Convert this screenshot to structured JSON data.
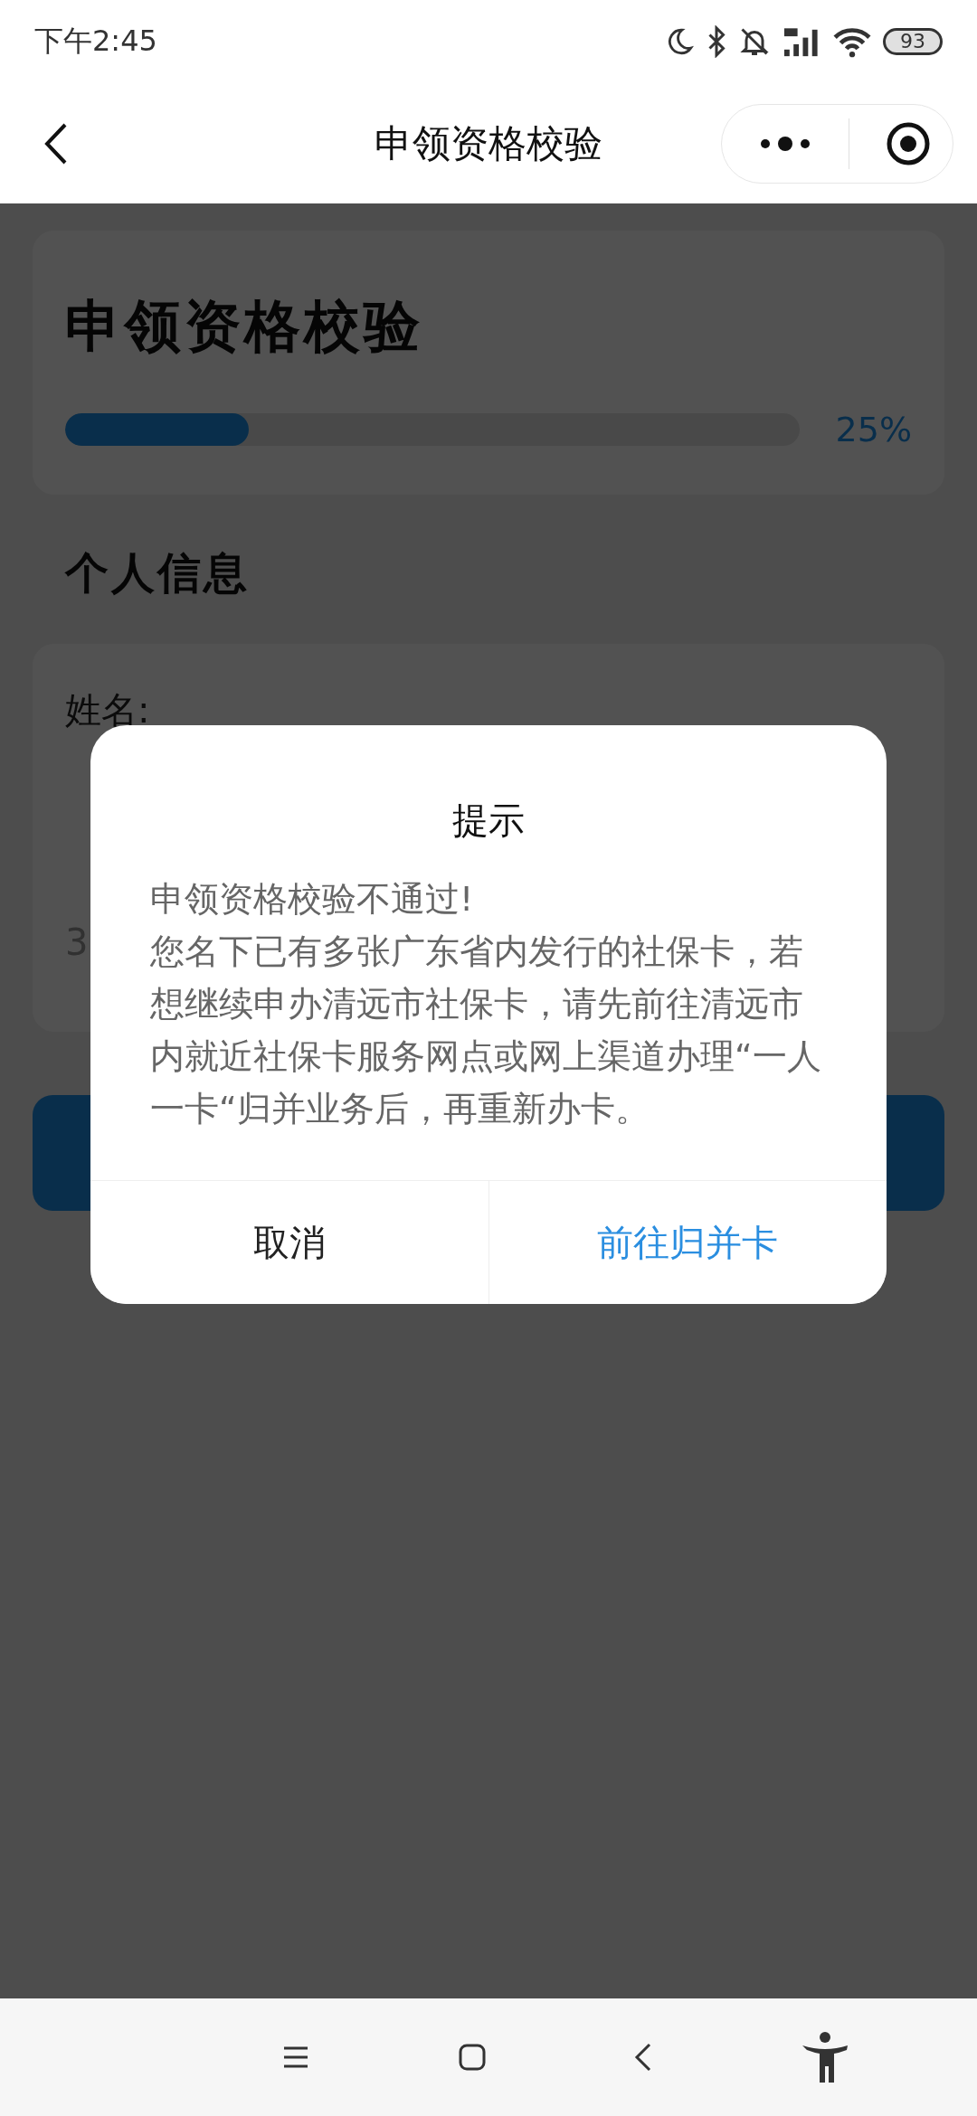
{
  "status_bar": {
    "time": "下午2:45",
    "battery": "93"
  },
  "header": {
    "title": "申领资格校验"
  },
  "progress_card": {
    "title": "申领资格校验",
    "level": 0.25,
    "reading": "25%"
  },
  "section_title": "个人信息",
  "fields": [
    {
      "label": "姓名:"
    },
    {
      "value": "3"
    }
  ],
  "dialog": {
    "title": "提示",
    "message": [
      "申领资格校验不通过!",
      "您名下已有多张广东省内发行的社保卡，若想继续申办清远市社保卡，请先前往清远市内就近社保卡服务网点或网上渠道办理“一人一卡“归并业务后，再重新办卡。"
    ],
    "buttons": [
      {
        "label": "取消",
        "kind": "cancel"
      },
      {
        "label": "前往归并卡",
        "kind": "confirm"
      }
    ]
  }
}
